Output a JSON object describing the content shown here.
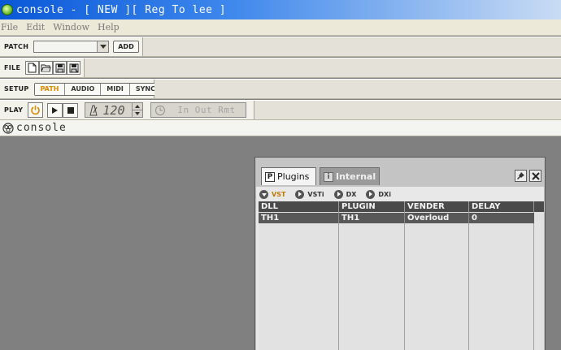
{
  "window": {
    "title": "console - [ NEW ][ Reg To lee ]"
  },
  "menu": {
    "items": [
      "File",
      "Edit",
      "Window",
      "Help"
    ]
  },
  "toolbar": {
    "patch": {
      "label": "PATCH",
      "add_label": "ADD",
      "selected": ""
    },
    "file": {
      "label": "FILE"
    },
    "setup": {
      "label": "SETUP",
      "tabs": [
        "PATH",
        "AUDIO",
        "MIDI",
        "SYNC"
      ],
      "active": "PATH"
    },
    "play": {
      "label": "PLAY",
      "tempo": "120",
      "io_label": "In Out Rmt"
    }
  },
  "console": {
    "title": "console"
  },
  "plugins_panel": {
    "tabs": [
      {
        "icon_letter": "P",
        "label": "Plugins"
      },
      {
        "icon_letter": "i",
        "label": "Internal"
      }
    ],
    "filters": [
      "VST",
      "VSTi",
      "DX",
      "DXi"
    ],
    "active_filter": "VST",
    "columns": [
      "DLL",
      "PLUGIN",
      "VENDER",
      "DELAY"
    ],
    "rows": [
      [
        "TH1",
        "TH1",
        "Overloud",
        "0"
      ]
    ]
  },
  "colors": {
    "titlebar_start": "#0a58d8",
    "accent_orange": "#d88a00",
    "workspace": "#808080"
  }
}
